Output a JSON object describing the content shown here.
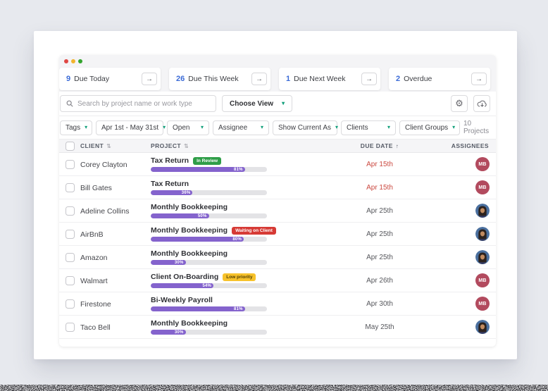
{
  "window": {
    "traffic_light_colors": {
      "close": "#df4744",
      "minimize": "#f2b42d",
      "zoom": "#34a42e"
    }
  },
  "stats": {
    "arrow_icon": "→",
    "items": [
      {
        "count": "9",
        "label": "Due Today"
      },
      {
        "count": "26",
        "label": "Due This Week"
      },
      {
        "count": "1",
        "label": "Due Next Week"
      },
      {
        "count": "2",
        "label": "Overdue"
      }
    ]
  },
  "toolbar": {
    "search_placeholder": "Search by project name or work type",
    "choose_view_label": "Choose View",
    "chevron_icon": "▾",
    "gear_icon": "⚙"
  },
  "filters": {
    "chevron_icon": "▾",
    "items": [
      "Tags",
      "Apr 1st - May 31st",
      "Open",
      "Assignee",
      "Show Current As",
      "Clients",
      "Client Groups"
    ],
    "projects_count": "10 Projects"
  },
  "table": {
    "headers": {
      "client": "CLIENT",
      "project": "PROJECT",
      "due": "DUE DATE",
      "assignees": "ASSIGNEES"
    },
    "sort_both_icon": "⇅",
    "sort_asc_icon": "↑",
    "rows": [
      {
        "client": "Corey Clayton",
        "project": "Tax Return",
        "badge": {
          "label": "In Review",
          "type": "green"
        },
        "progress": 81,
        "progress_label": "81%",
        "due": "Apr 15th",
        "overdue": true,
        "assignee": {
          "type": "initials",
          "initials": "MB"
        }
      },
      {
        "client": "Bill Gates",
        "project": "Tax Return",
        "badge": null,
        "progress": 36,
        "progress_label": "36%",
        "due": "Apr 15th",
        "overdue": true,
        "assignee": {
          "type": "initials",
          "initials": "MB"
        }
      },
      {
        "client": "Adeline Collins",
        "project": "Monthly Bookkeeping",
        "badge": null,
        "progress": 50,
        "progress_label": "50%",
        "due": "Apr 25th",
        "overdue": false,
        "assignee": {
          "type": "photo"
        }
      },
      {
        "client": "AirBnB",
        "project": "Monthly Bookkeeping",
        "badge": {
          "label": "Waiting on Client",
          "type": "red"
        },
        "progress": 80,
        "progress_label": "80%",
        "due": "Apr 25th",
        "overdue": false,
        "assignee": {
          "type": "photo"
        }
      },
      {
        "client": "Amazon",
        "project": "Monthly Bookkeeping",
        "badge": null,
        "progress": 30,
        "progress_label": "30%",
        "due": "Apr 25th",
        "overdue": false,
        "assignee": {
          "type": "photo"
        }
      },
      {
        "client": "Walmart",
        "project": "Client On-Boarding",
        "badge": {
          "label": "Low priority",
          "type": "yellow"
        },
        "progress": 54,
        "progress_label": "54%",
        "due": "Apr 26th",
        "overdue": false,
        "assignee": {
          "type": "initials",
          "initials": "MB"
        }
      },
      {
        "client": "Firestone",
        "project": "Bi-Weekly Payroll",
        "badge": null,
        "progress": 81,
        "progress_label": "81%",
        "due": "Apr 30th",
        "overdue": false,
        "assignee": {
          "type": "initials",
          "initials": "MB"
        }
      },
      {
        "client": "Taco Bell",
        "project": "Monthly Bookkeeping",
        "badge": null,
        "progress": 30,
        "progress_label": "30%",
        "due": "May 25th",
        "overdue": false,
        "assignee": {
          "type": "photo"
        }
      }
    ]
  },
  "colors": {
    "accent_green": "#12a07b",
    "stat_count_blue": "#3b6bd7",
    "overdue_red": "#cb4940",
    "progress_purple": "#8463cd",
    "badge_green": "#2f9e48",
    "badge_red": "#d63a35",
    "badge_yellow": "#f7c22b",
    "avatar_maroon": "#b24a5e"
  }
}
